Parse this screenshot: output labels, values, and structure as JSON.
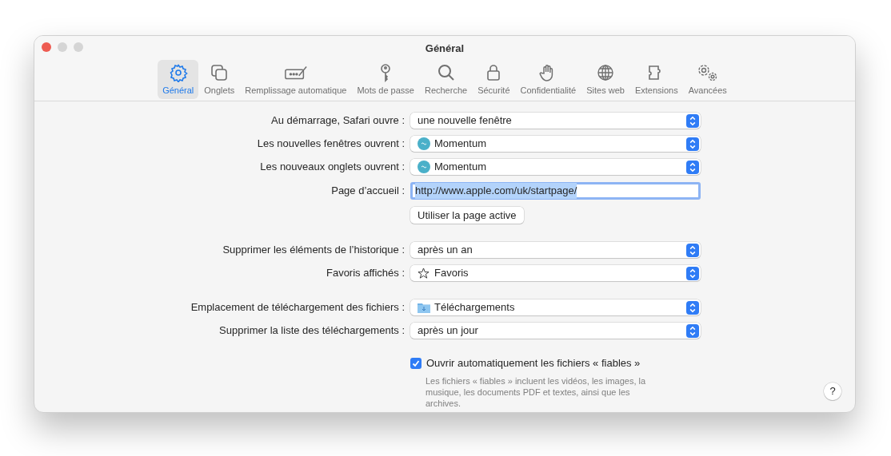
{
  "window": {
    "title": "Général"
  },
  "tabs": [
    {
      "label": "Général",
      "selected": true
    },
    {
      "label": "Onglets",
      "selected": false
    },
    {
      "label": "Remplissage automatique",
      "selected": false
    },
    {
      "label": "Mots de passe",
      "selected": false
    },
    {
      "label": "Recherche",
      "selected": false
    },
    {
      "label": "Sécurité",
      "selected": false
    },
    {
      "label": "Confidentialité",
      "selected": false
    },
    {
      "label": "Sites web",
      "selected": false
    },
    {
      "label": "Extensions",
      "selected": false
    },
    {
      "label": "Avancées",
      "selected": false
    }
  ],
  "sections": [
    {
      "rows": [
        {
          "kind": "popup",
          "label": "Au démarrage, Safari ouvre :",
          "value": "une nouvelle fenêtre"
        },
        {
          "kind": "popup",
          "label": "Les nouvelles fenêtres ouvrent :",
          "value": "Momentum"
        },
        {
          "kind": "popup",
          "label": "Les nouveaux onglets ouvrent :",
          "value": "Momentum"
        },
        {
          "kind": "field",
          "label": "Page d’accueil :",
          "value": "http://www.apple.com/uk/startpage/",
          "focused": true
        },
        {
          "kind": "button",
          "label": "Utiliser la page active"
        }
      ]
    },
    {
      "rows": [
        {
          "kind": "popup",
          "label": "Supprimer les éléments de l’historique :",
          "value": "après un an"
        },
        {
          "kind": "popup",
          "label": "Favoris affichés :",
          "value": "Favoris"
        }
      ]
    },
    {
      "rows": [
        {
          "kind": "popup",
          "label": "Emplacement de téléchargement des fichiers :",
          "value": "Téléchargements"
        },
        {
          "kind": "popup",
          "label": "Supprimer la liste des téléchargements :",
          "value": "après un jour"
        },
        {
          "kind": "checkbox",
          "label": "Ouvrir automatiquement les fichiers « fiables »",
          "checked": true,
          "note": "Les fichiers « fiables » incluent les vidéos, les images, la musique, les documents PDF et textes, ainsi que les archives."
        }
      ]
    }
  ],
  "help_button": "?"
}
